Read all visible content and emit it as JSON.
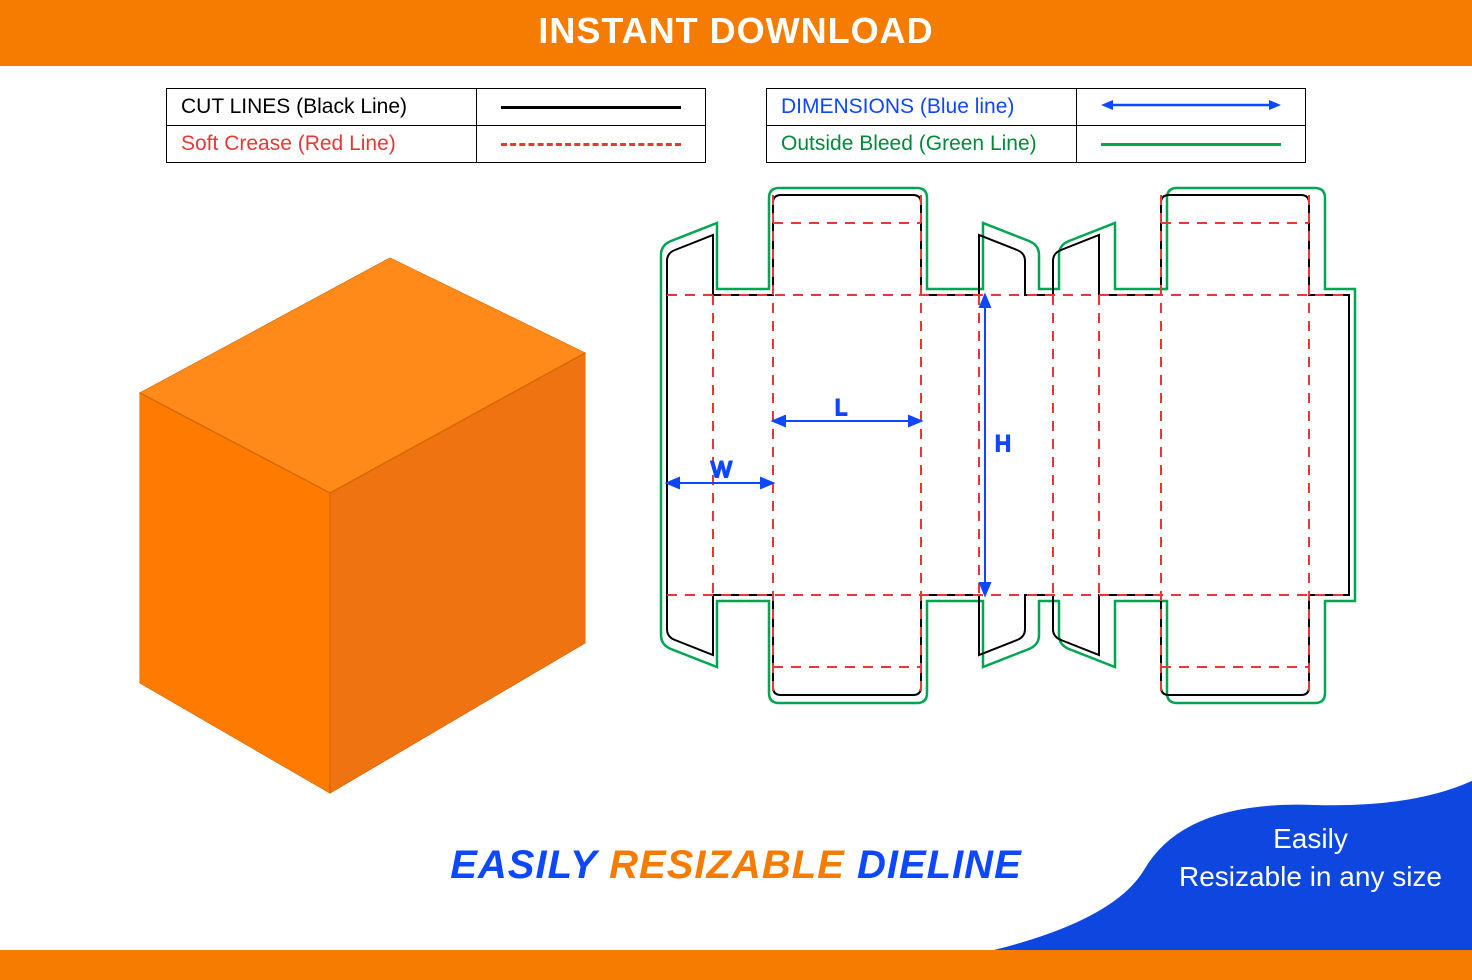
{
  "banner_top": "INSTANT DOWNLOAD",
  "legend": {
    "cut": "CUT LINES (Black Line)",
    "crease": "Soft Crease (Red Line)",
    "dimensions": "DIMENSIONS (Blue line)",
    "bleed": "Outside Bleed (Green Line)"
  },
  "dims": {
    "w": "W",
    "l": "L",
    "h": "H"
  },
  "tagline": {
    "easily": "EASILY",
    "resizable": "RESIZABLE",
    "dieline": "DIELINE"
  },
  "corner": {
    "line1": "Easily",
    "line2": "Resizable in any size"
  },
  "colors": {
    "orange": "#f57c00",
    "blue": "#0d47ff",
    "red": "#e53935",
    "green": "#00a651"
  }
}
